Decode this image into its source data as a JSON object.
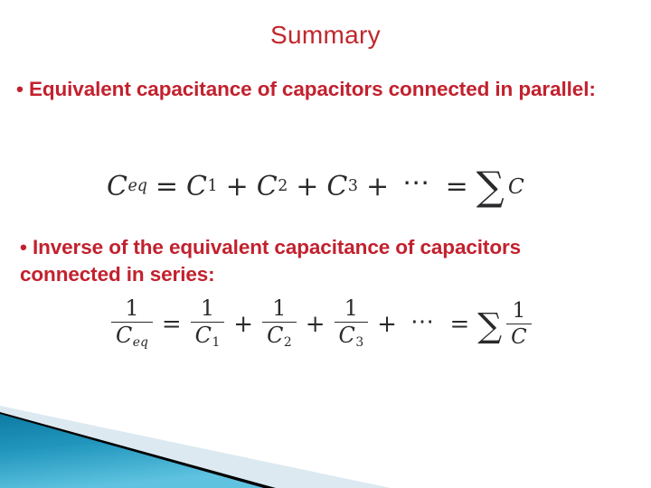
{
  "slide": {
    "title": "Summary",
    "bullets": [
      {
        "marker": "•",
        "text": "Equivalent capacitance of capacitors connected in parallel:"
      },
      {
        "marker": "•",
        "text": "Inverse of the equivalent capacitance of capacitors connected in series:"
      }
    ],
    "formulas": {
      "parallel": {
        "plain": "Ceq = C1 + C2 + C3 + ⋯ = ∑C",
        "lhs_var": "C",
        "lhs_sub": "eq",
        "eq1": "=",
        "t1_var": "C",
        "t1_sub": "1",
        "plus1": "+",
        "t2_var": "C",
        "t2_sub": "2",
        "plus2": "+",
        "t3_var": "C",
        "t3_sub": "3",
        "plus3": "+",
        "dots": "⋯",
        "eq2": "=",
        "sigma": "∑",
        "sum_var": "C"
      },
      "series": {
        "plain": "1/Ceq = 1/C1 + 1/C2 + 1/C3 + ⋯ = ∑ 1/C",
        "one": "1",
        "lhs_var": "C",
        "lhs_sub": "eq",
        "eq1": "=",
        "t1_var": "C",
        "t1_sub": "1",
        "plus1": "+",
        "t2_var": "C",
        "t2_sub": "2",
        "plus2": "+",
        "t3_var": "C",
        "t3_sub": "3",
        "plus3": "+",
        "dots": "⋯",
        "eq2": "=",
        "sigma": "∑",
        "sum_var": "C"
      }
    }
  },
  "colors": {
    "title_red": "#c0272d",
    "body_red": "#c2212e",
    "formula_ink": "#2a2a2c",
    "accent_blue_dark": "#0f7fa6",
    "accent_blue_mid": "#2e9ec4",
    "accent_blue_light": "#5cbfde",
    "accent_pale": "#dce9f0",
    "accent_black": "#000000",
    "background": "#ffffff"
  },
  "footer_art": {
    "name": "decorative-corner-graphic",
    "shapes": [
      "blue-gradient-triangle",
      "black-diagonal-stripe",
      "pale-blue-wedge"
    ]
  }
}
